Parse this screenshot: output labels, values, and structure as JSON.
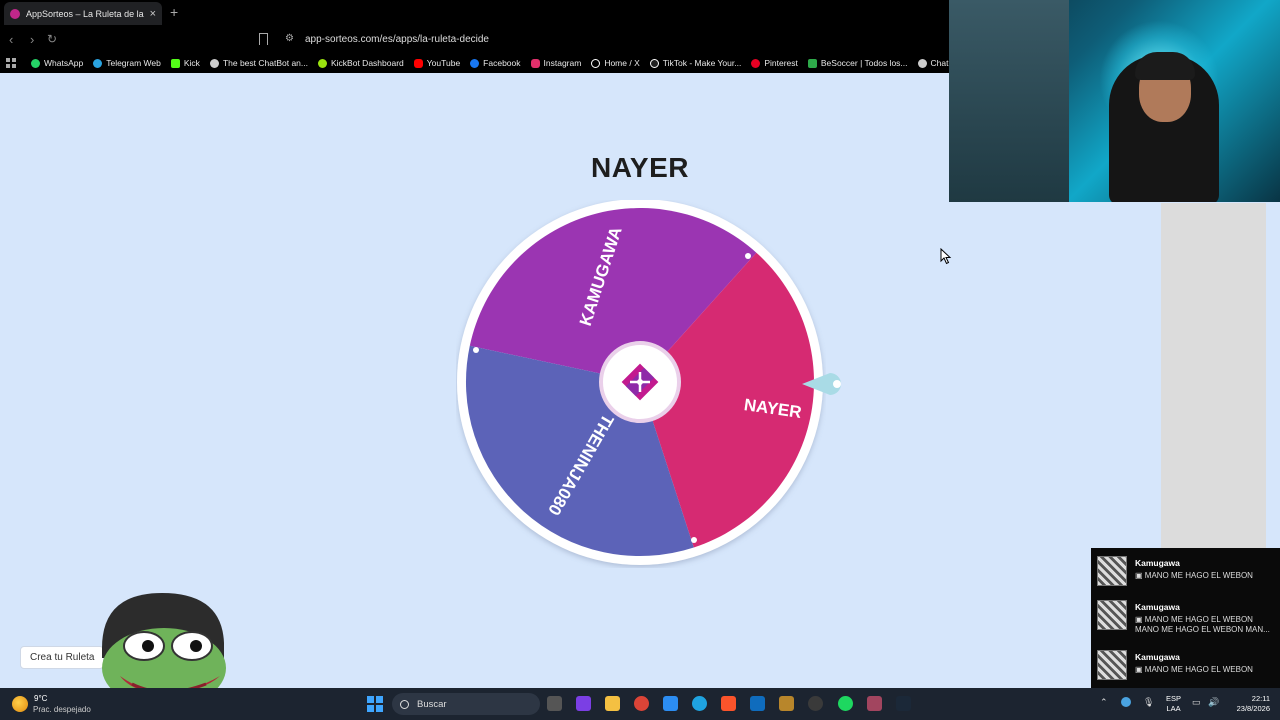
{
  "browser": {
    "tab_title": "AppSorteos – La Ruleta de la Suerte",
    "url": "app-sorteos.com/es/apps/la-ruleta-decide",
    "bookmarks": [
      {
        "label": "WhatsApp",
        "color": "#25d366"
      },
      {
        "label": "Telegram Web",
        "color": "#2aa3e0"
      },
      {
        "label": "Kick",
        "color": "#53fc18"
      },
      {
        "label": "The best ChatBot an...",
        "color": "#cccccc"
      },
      {
        "label": "KickBot Dashboard",
        "color": "#9be30f"
      },
      {
        "label": "YouTube",
        "color": "#ff0000"
      },
      {
        "label": "Facebook",
        "color": "#1877f2"
      },
      {
        "label": "Instagram",
        "color": "#e1306c"
      },
      {
        "label": "Home / X",
        "color": "#ffffff"
      },
      {
        "label": "TikTok - Make Your...",
        "color": "#ffffff"
      },
      {
        "label": "Pinterest",
        "color": "#e60023"
      },
      {
        "label": "BeSoccer | Todos los...",
        "color": "#2eaa4a"
      },
      {
        "label": "ChatGPT",
        "color": "#cccccc"
      }
    ]
  },
  "roulette": {
    "result": "NAYER",
    "segments": [
      {
        "label": "KAMUGAWA",
        "color": "#9b35b2"
      },
      {
        "label": "NAYER",
        "color": "#d62a72"
      },
      {
        "label": "THENINJA080",
        "color": "#5c63b8"
      }
    ],
    "create_button": "Crea tu Ruleta"
  },
  "chat": {
    "messages": [
      {
        "user": "Kamugawa",
        "lines": [
          "MANO ME HAGO EL WEBON"
        ]
      },
      {
        "user": "Kamugawa",
        "lines": [
          "MANO ME HAGO EL WEBON",
          "MANO ME HAGO EL WEBON MAN..."
        ]
      },
      {
        "user": "Kamugawa",
        "lines": [
          "MANO ME HAGO EL WEBON"
        ]
      }
    ]
  },
  "taskbar": {
    "temperature": "9°C",
    "weather": "Prac. despejado",
    "search_label": "Buscar",
    "lang_top": "ESP",
    "lang_bottom": "LAA",
    "time": "22:11",
    "date": "23/8/2026"
  }
}
